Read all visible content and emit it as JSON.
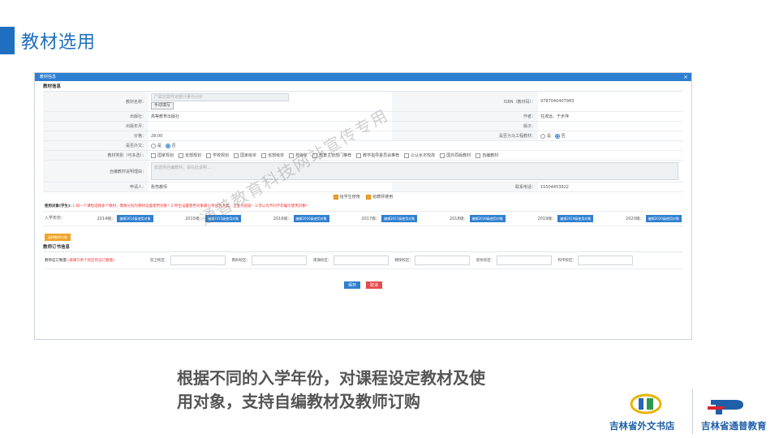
{
  "slide": {
    "title": "教材选用",
    "caption_line1": "根据不同的入学年份，对课程设定教材及使",
    "caption_line2": "用对象，支持自编教材及教师订购",
    "watermark": "通普教育科技网站宣传专用",
    "logo1_text": "吉林省外文书店",
    "logo2_text": "吉林省通普教育"
  },
  "window": {
    "title": "教材信息",
    "close": "×",
    "section_info": "教材信息",
    "fields": {
      "name_label": "教材名称：",
      "name_value": "广联达软件定额计量与计价",
      "manual_btn": "手动填写",
      "isbn_label": "ISBN（教材码）：",
      "isbn_value": "9787040407983",
      "publisher_label": "出版社：",
      "publisher_value": "高等教育出版社",
      "author_label": "作者：",
      "author_value": "任淑远、于步萍",
      "pubdate_label": "出版年月：",
      "pubdate_value": "",
      "edition_label": "版次：",
      "edition_value": "",
      "price_label": "价格：",
      "price_value": "28.00",
      "mark_label": "是否为马工程教材：",
      "yes": "是",
      "no": "否",
      "foreign_label": "是否外文：",
      "category_label": "教材类别（可多选）：",
      "categories": [
        "国家规划",
        "省部规划",
        "学校规划",
        "国家级奖",
        "省部级奖",
        "校级奖",
        "教育主管部门推荐",
        "教学指导委员会推荐",
        "公认水平较高",
        "国外原版教材",
        "自编教材"
      ],
      "self_reason_label": "自编教材说明理由：",
      "self_reason_placeholder": "如选择自编教材，请在此说明...",
      "applicant_label": "申请人：",
      "applicant_value": "詹亮教师",
      "phone_label": "联系电话：",
      "phone_value": "15504453822",
      "student_use": "给学生使用",
      "teacher_use": "给教师使用"
    },
    "usage": {
      "label": "使用对象(学生):",
      "note": "1.如一个课程选择多个教材，需要分别为教材设置使用对象！2.所生设置使用对象最小单位为大类，全生为班级！3.可以为不同学年编写使用对象!"
    },
    "years_label": "入学年份：",
    "years": [
      {
        "year": "2014级：",
        "btn": "编辑2014级使用对象"
      },
      {
        "year": "2015级：",
        "btn": "编辑2015级使用对象"
      },
      {
        "year": "2016级：",
        "btn": "编辑2016级使用对象"
      },
      {
        "year": "2017级：",
        "btn": "编辑2017级使用对象"
      },
      {
        "year": "2018级：",
        "btn": "编辑2018级使用对象"
      },
      {
        "year": "2019级：",
        "btn": "编辑2019级使用对象"
      },
      {
        "year": "2020级：",
        "btn": "编辑2020级使用对象"
      }
    ],
    "teacher_btn": "选择教师对象",
    "section_order": "教师订书信息",
    "order_label": "教师征订数量:",
    "order_note": "(请填写各个校区的征订数量)",
    "campuses": [
      "前卫校区：",
      "南岭校区：",
      "南湖校区：",
      "朝阳校区：",
      "新民校区：",
      "和平校区："
    ],
    "save": "保存",
    "cancel": "取消"
  },
  "colors": {
    "accent": "#1e6fbf",
    "titlebar": "#2f7fd0",
    "orange": "#f0a428",
    "red": "#e54b4b"
  }
}
